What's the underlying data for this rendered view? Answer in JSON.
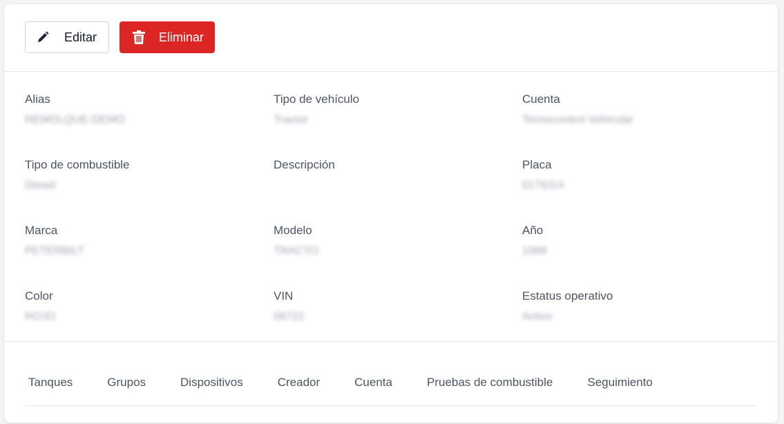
{
  "toolbar": {
    "edit_label": "Editar",
    "delete_label": "Eliminar",
    "edit_icon": "pencil-icon",
    "delete_icon": "trash-icon",
    "delete_color": "#dc2626"
  },
  "fields": [
    {
      "label": "Alias",
      "value": "REMOLQUE-DEMO"
    },
    {
      "label": "Tipo de vehículo",
      "value": "Tractor"
    },
    {
      "label": "Cuenta",
      "value": "Tecnocontrol Vehicular"
    },
    {
      "label": "Tipo de combustible",
      "value": "Diesel"
    },
    {
      "label": "Descripción",
      "value": ""
    },
    {
      "label": "Placa",
      "value": "01TEGX"
    },
    {
      "label": "Marca",
      "value": "PETERBILT"
    },
    {
      "label": "Modelo",
      "value": "TRACTO"
    },
    {
      "label": "Año",
      "value": "1988"
    },
    {
      "label": "Color",
      "value": "ROJO"
    },
    {
      "label": "VIN",
      "value": "08722"
    },
    {
      "label": "Estatus operativo",
      "value": "Activo"
    }
  ],
  "tabs": [
    "Tanques",
    "Grupos",
    "Dispositivos",
    "Creador",
    "Cuenta",
    "Pruebas de combustible",
    "Seguimiento"
  ]
}
